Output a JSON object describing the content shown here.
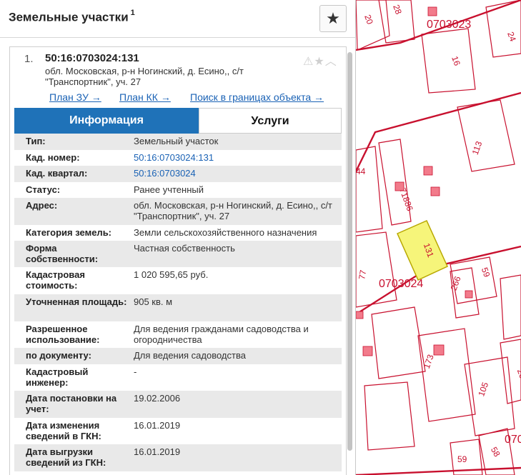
{
  "panel": {
    "title": "Земельные участки",
    "title_count": "1",
    "star_icon": "star-icon"
  },
  "card": {
    "index": "1.",
    "cad_number": "50:16:0703024:131",
    "address": "обл. Московская, р-н Ногинский, д. Есино,, с/т \"Транспортник\", уч. 27",
    "icons": "⚠★^",
    "links": {
      "plan_zu": "План ЗУ →",
      "plan_kk": "План КК →",
      "search": "Поиск в границах объекта →"
    },
    "tabs": {
      "info": "Информация",
      "services": "Услуги"
    },
    "rows": [
      {
        "label": "Тип:",
        "value": "Земельный участок"
      },
      {
        "label": "Кад. номер:",
        "value": "50:16:0703024:131"
      },
      {
        "label": "Кад. квартал:",
        "value": "50:16:0703024"
      },
      {
        "label": "Статус:",
        "value": "Ранее учтенный"
      },
      {
        "label": "Адрес:",
        "value": "обл. Московская, р-н Ногинский, д. Есино,, с/т \"Транспортник\", уч. 27"
      },
      {
        "label": "Категория земель:",
        "value": "Земли сельскохозяйственного назначения"
      },
      {
        "label": "Форма собственности:",
        "value": "Частная собственность"
      },
      {
        "label": "Кадастровая стоимость:",
        "value": "1 020 595,65 руб."
      },
      {
        "label": "Уточненная площадь:",
        "value": "905 кв. м"
      },
      {
        "label": "Разрешенное использование:",
        "value": "Для ведения гражданами садоводства и огородничества"
      },
      {
        "label": "по документу:",
        "value": "Для ведения садоводства"
      },
      {
        "label": "Кадастровый инженер:",
        "value": "-"
      },
      {
        "label": "Дата постановки на учет:",
        "value": "19.02.2006"
      },
      {
        "label": "Дата изменения сведений в ГКН:",
        "value": "16.01.2019"
      },
      {
        "label": "Дата выгрузки сведений из ГКН:",
        "value": "16.01.2019"
      }
    ]
  },
  "map": {
    "labels": {
      "q23": "0703023",
      "q24": "0703024",
      "q07": "070",
      "p20": "20",
      "p28": "28",
      "p24": "24",
      "p16": "16",
      "p113": "113",
      "p44": "44",
      "p71886": "71886",
      "p131": "131",
      "p77": "77",
      "p59a": "59",
      "p266": "266",
      "p173": "173",
      "p105": "105",
      "p20b": "20",
      "p59b": "59",
      "p58": "58"
    },
    "colors": {
      "boundary": "#c8102e",
      "selected_fill": "#f6f57a",
      "selected_stroke": "#b8a800"
    }
  }
}
